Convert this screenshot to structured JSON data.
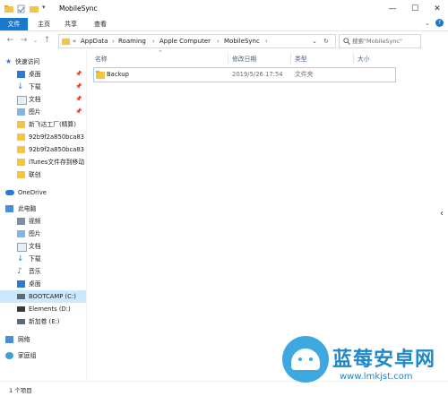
{
  "window": {
    "title": "MobileSync"
  },
  "ribbon": {
    "tabs": [
      "文件",
      "主页",
      "共享",
      "查看"
    ]
  },
  "address": {
    "overflow": "«",
    "crumbs": [
      "AppData",
      "Roaming",
      "Apple Computer",
      "MobileSync"
    ]
  },
  "search": {
    "placeholder": "搜索\"MobileSync\""
  },
  "sidebar": {
    "quick_access": "快速访问",
    "quick_items": [
      "桌面",
      "下载",
      "文档",
      "图片",
      "新飞达工厂(精算)",
      "92b9f2a850bca83",
      "92b9f2a850bca83",
      "iTunes文件存到移动",
      "联创"
    ],
    "onedrive": "OneDrive",
    "this_pc": "此电脑",
    "pc_items": [
      "视频",
      "图片",
      "文档",
      "下载",
      "音乐",
      "桌面"
    ],
    "drives": [
      "BOOTCAMP (C:)",
      "Elements (D:)",
      "新加卷 (E:)"
    ],
    "network": "网络",
    "homegroup": "家庭组"
  },
  "columns": [
    "名称",
    "修改日期",
    "类型",
    "大小"
  ],
  "files": [
    {
      "name": "Backup",
      "modified": "2019/5/26 17:54",
      "type": "文件夹",
      "size": ""
    }
  ],
  "status": {
    "item_count": "1 个项目"
  },
  "watermark": {
    "brand": "蓝莓安卓网",
    "url": "www.lmkjst.com"
  },
  "colors": {
    "accent": "#1979ca",
    "selection": "#cce8ff",
    "folder": "#f4c542"
  }
}
